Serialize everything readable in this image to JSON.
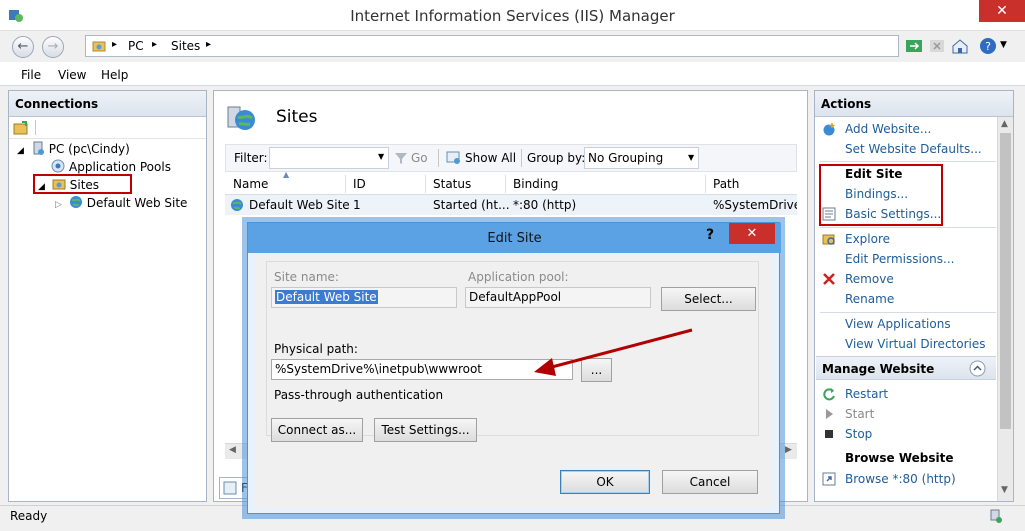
{
  "window": {
    "title": "Internet Information Services (IIS) Manager",
    "close": "✕"
  },
  "address": {
    "parts": [
      "PC",
      "Sites"
    ]
  },
  "menu": [
    "File",
    "View",
    "Help"
  ],
  "connections": {
    "header": "Connections",
    "tree": {
      "root": "PC (pc\\Cindy)",
      "app_pools": "Application Pools",
      "sites": "Sites",
      "default_site": "Default Web Site"
    }
  },
  "center": {
    "title": "Sites",
    "filter_label": "Filter:",
    "go_label": "Go",
    "show_all_label": "Show All",
    "groupby_label": "Group by:",
    "groupby_value": "No Grouping",
    "columns": [
      "Name",
      "ID",
      "Status",
      "Binding",
      "Path"
    ],
    "rows": [
      {
        "name": "Default Web Site",
        "id": "1",
        "status": "Started (ht...",
        "binding": "*:80 (http)",
        "path": "%SystemDrive%"
      }
    ],
    "bottom_tab": "Fe"
  },
  "actions": {
    "header": "Actions",
    "add_website": "Add Website...",
    "set_defaults": "Set Website Defaults...",
    "edit_site_header": "Edit Site",
    "bindings": "Bindings...",
    "basic_settings": "Basic Settings...",
    "explore": "Explore",
    "edit_permissions": "Edit Permissions...",
    "remove": "Remove",
    "rename": "Rename",
    "view_applications": "View Applications",
    "view_vdirs": "View Virtual Directories",
    "manage_header": "Manage Website",
    "restart": "Restart",
    "start": "Start",
    "stop": "Stop",
    "browse_header": "Browse Website",
    "browse_80": "Browse *:80 (http)"
  },
  "dialog": {
    "title": "Edit Site",
    "help": "?",
    "close": "✕",
    "site_name_label": "Site name:",
    "site_name_value": "Default Web Site",
    "app_pool_label": "Application pool:",
    "app_pool_value": "DefaultAppPool",
    "select_button": "Select...",
    "physical_path_label": "Physical path:",
    "physical_path_value": "%SystemDrive%\\inetpub\\wwwroot",
    "browse_button": "...",
    "pass_through": "Pass-through authentication",
    "connect_as": "Connect as...",
    "test_settings": "Test Settings...",
    "ok": "OK",
    "cancel": "Cancel"
  },
  "status": {
    "text": "Ready"
  },
  "colors": {
    "highlight": "#c00000",
    "link": "#1f5c99",
    "dialog_title": "#5aa2e4"
  }
}
